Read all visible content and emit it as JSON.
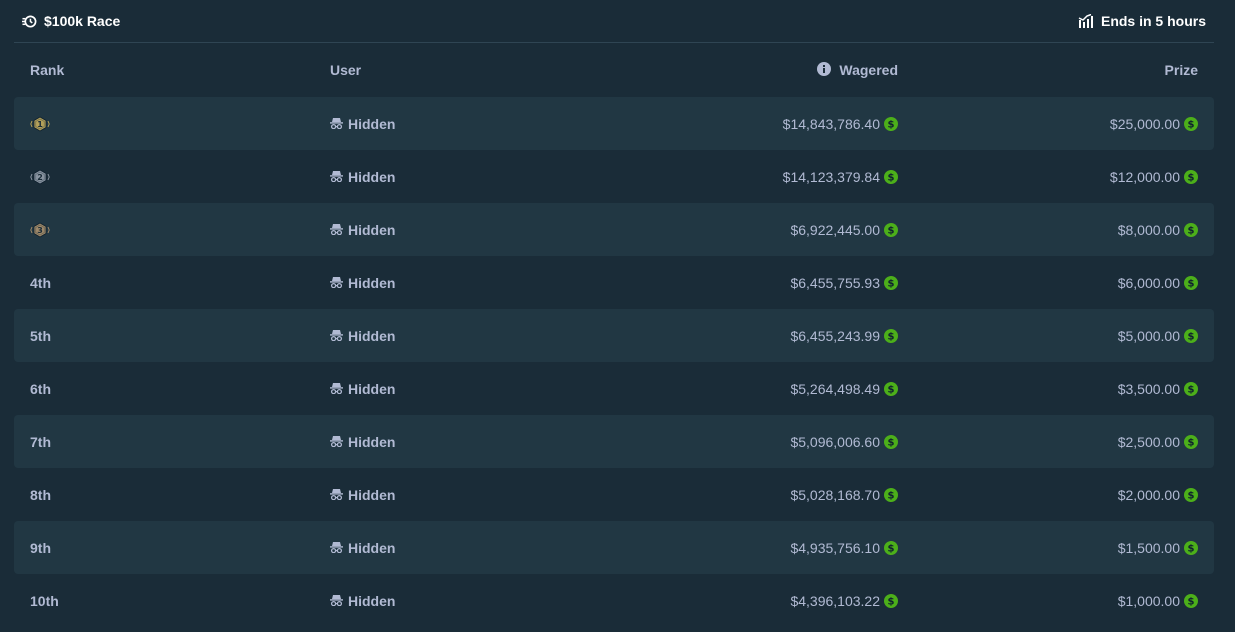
{
  "header": {
    "race_title": "$100k Race",
    "ends_text": "Ends in 5 hours"
  },
  "table": {
    "columns": {
      "rank": "Rank",
      "user": "User",
      "wagered": "Wagered",
      "prize": "Prize"
    },
    "rows": [
      {
        "rank": "1",
        "rank_type": "medal-gold",
        "user": "Hidden",
        "wagered": "$14,843,786.40",
        "prize": "$25,000.00"
      },
      {
        "rank": "2",
        "rank_type": "medal-silver",
        "user": "Hidden",
        "wagered": "$14,123,379.84",
        "prize": "$12,000.00"
      },
      {
        "rank": "3",
        "rank_type": "medal-bronze",
        "user": "Hidden",
        "wagered": "$6,922,445.00",
        "prize": "$8,000.00"
      },
      {
        "rank": "4th",
        "rank_type": "text",
        "user": "Hidden",
        "wagered": "$6,455,755.93",
        "prize": "$6,000.00"
      },
      {
        "rank": "5th",
        "rank_type": "text",
        "user": "Hidden",
        "wagered": "$6,455,243.99",
        "prize": "$5,000.00"
      },
      {
        "rank": "6th",
        "rank_type": "text",
        "user": "Hidden",
        "wagered": "$5,264,498.49",
        "prize": "$3,500.00"
      },
      {
        "rank": "7th",
        "rank_type": "text",
        "user": "Hidden",
        "wagered": "$5,096,006.60",
        "prize": "$2,500.00"
      },
      {
        "rank": "8th",
        "rank_type": "text",
        "user": "Hidden",
        "wagered": "$5,028,168.70",
        "prize": "$2,000.00"
      },
      {
        "rank": "9th",
        "rank_type": "text",
        "user": "Hidden",
        "wagered": "$4,935,756.10",
        "prize": "$1,500.00"
      },
      {
        "rank": "10th",
        "rank_type": "text",
        "user": "Hidden",
        "wagered": "$4,396,103.22",
        "prize": "$1,000.00"
      }
    ]
  },
  "icons": {
    "race": "race-icon",
    "timer": "chart-icon",
    "info": "info-icon",
    "hidden_user": "incognito-icon",
    "currency": "dollar-coin-icon"
  },
  "colors": {
    "background": "#1a2c38",
    "row_alt": "#213743",
    "text": "#b1bad3",
    "white": "#ffffff",
    "coin": "#4caf1a",
    "medal_gold": "#b3a05a",
    "medal_silver": "#8b96a3",
    "medal_bronze": "#a08a6a"
  }
}
